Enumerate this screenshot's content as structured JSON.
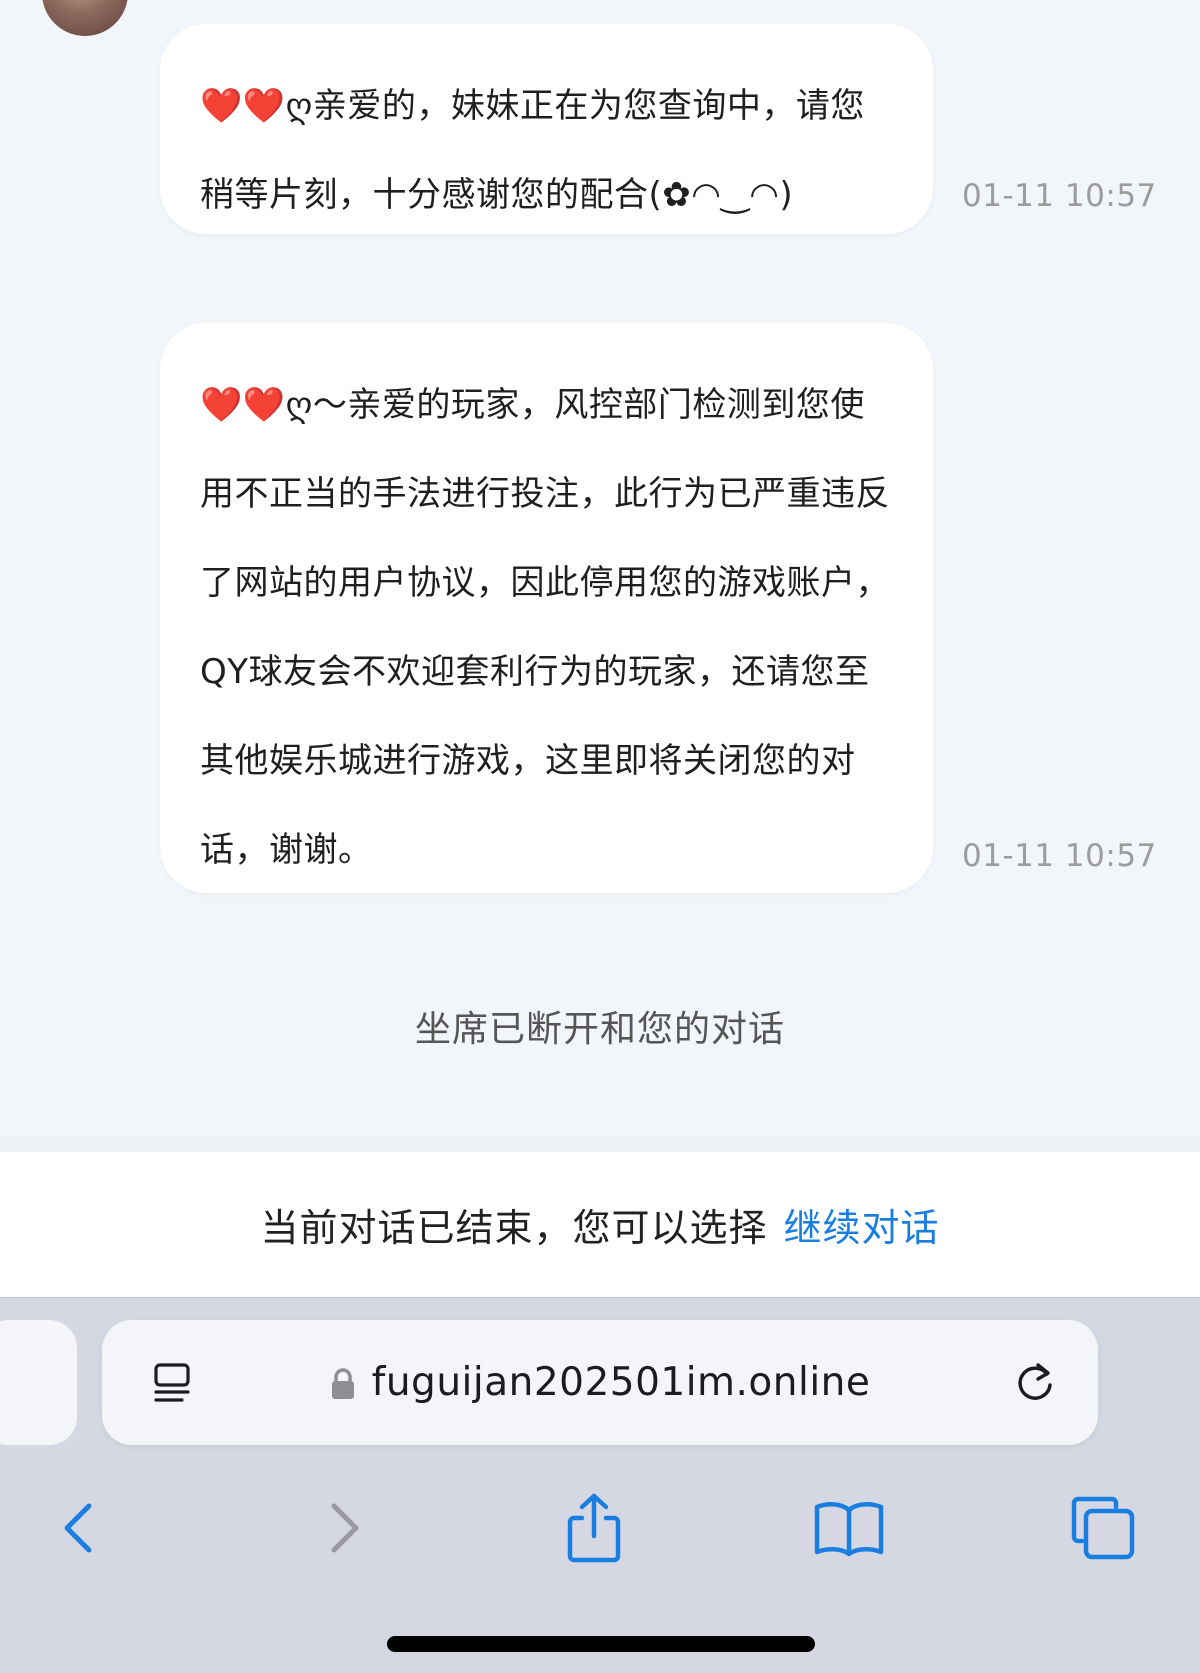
{
  "messages": [
    {
      "text": "❤️❤️ღ亲爱的，妹妹正在为您查询中，请您稍等片刻，十分感谢您的配合(✿◠‿◠)",
      "time": "01-11 10:57"
    },
    {
      "text": "❤️❤️ღ～亲爱的玩家，风控部门检测到您使用不正当的手法进行投注，此行为已严重违反了网站的用户协议，因此停用您的游戏账户，QY球友会不欢迎套利行为的玩家，还请您至其他娱乐城进行游戏，这里即将关闭您的对话，谢谢。",
      "time": "01-11 10:57"
    }
  ],
  "system_notice": "坐席已断开和您的对话",
  "ended_bar": {
    "text": "当前对话已结束，您可以选择",
    "link": "继续对话",
    "link_color": "#1a7ee0"
  },
  "browser": {
    "url": "fuguijan202501im.online",
    "icons": {
      "reader": "reader-mode-icon",
      "lock": "lock-icon",
      "reload": "reload-icon",
      "back": "back-icon",
      "forward": "forward-icon",
      "share": "share-icon",
      "bookmarks": "bookmarks-icon",
      "tabs": "tabs-icon"
    },
    "accent_color": "#1a7ee0"
  }
}
